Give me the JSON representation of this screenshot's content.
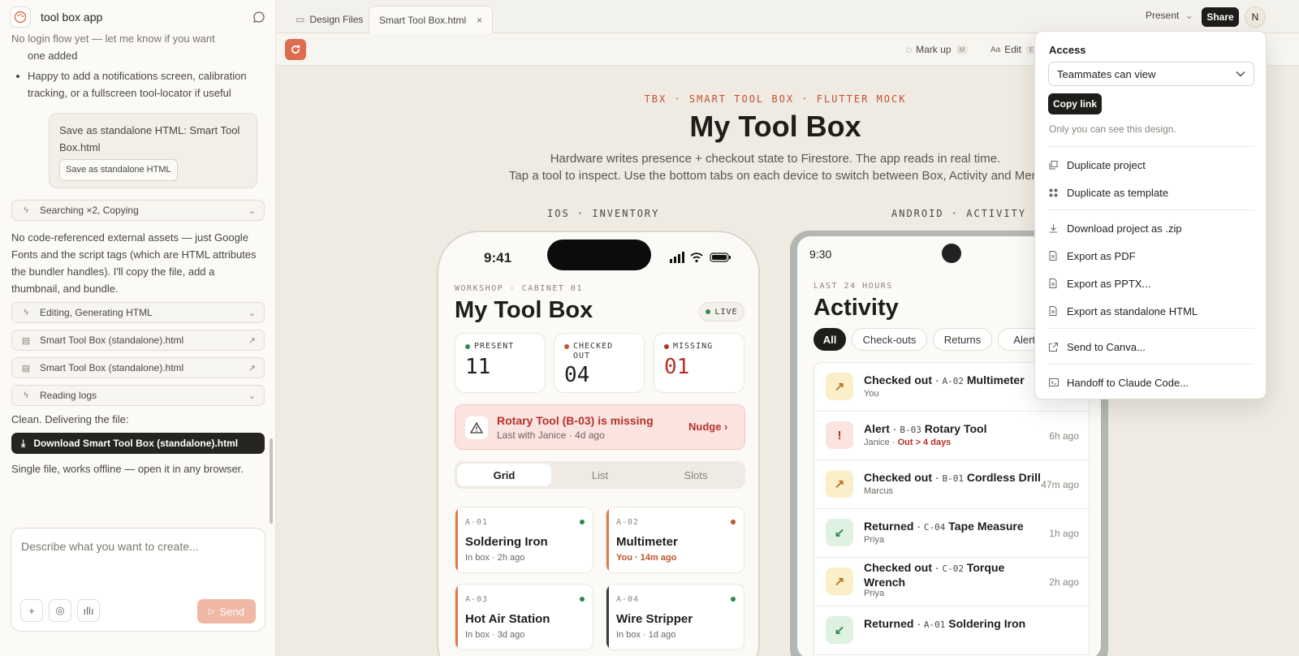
{
  "chat": {
    "project_title": "tool box app",
    "faded_line": "No login flow yet — let me know if you want",
    "faded_line2": "one added",
    "bullet": "Happy to add a notifications screen, calibration tracking, or a fullscreen tool-locator if useful",
    "user_msg": "Save as standalone HTML: Smart Tool Box.html",
    "user_chip": "Save as standalone HTML",
    "step1": "Searching ×2, Copying",
    "para1": "No code-referenced external assets — just Google Fonts and the script tags (which are HTML attributes the bundler handles). I'll copy the file, add a thumbnail, and bundle.",
    "step2": "Editing, Generating HTML",
    "file1": "Smart Tool Box (standalone).html",
    "file2": "Smart Tool Box (standalone).html",
    "step3": "Reading logs",
    "para2": "Clean. Delivering the file:",
    "download_label": "Download Smart Tool Box (standalone).html",
    "para3": "Single file, works offline — open it in any browser.",
    "composer_placeholder": "Describe what you want to create...",
    "send_label": "Send"
  },
  "topbar": {
    "tab1": "Design Files",
    "tab2": "Smart Tool Box.html",
    "present": "Present",
    "share": "Share",
    "avatar": "N"
  },
  "canvas_tools": {
    "markup": "Mark up",
    "markup_key": "M",
    "edit": "Edit",
    "edit_key": "E"
  },
  "hero": {
    "eyebrow": "TBX · SMART TOOL BOX · FLUTTER MOCK",
    "title": "My Tool Box",
    "sub1": "Hardware writes presence + checkout state to Firestore. The app reads in real time.",
    "sub2": "Tap a tool to inspect. Use the bottom tabs on each device to switch between Box, Activity and Mem"
  },
  "ios": {
    "label": "IOS · INVENTORY",
    "time": "9:41",
    "eyebrow": "WORKSHOP · CABINET 01",
    "title": "My Tool Box",
    "live": "LIVE",
    "stats": [
      {
        "label": "PRESENT",
        "value": "11",
        "color": "#2f8a4c"
      },
      {
        "label": "CHECKED OUT",
        "value": "04",
        "color": "#c2512e"
      },
      {
        "label": "MISSING",
        "value": "01",
        "color": "#b4332a"
      }
    ],
    "alert_title": "Rotary Tool (B-03) is missing",
    "alert_sub": "Last with Janice · 4d ago",
    "nudge": "Nudge ›",
    "segments": [
      "Grid",
      "List",
      "Slots"
    ],
    "tools": [
      {
        "code": "A-01",
        "name": "Soldering Iron",
        "sub": "In box · 2h ago",
        "status_color": "#2f8a4c",
        "bar_color": "#e07a45"
      },
      {
        "code": "A-02",
        "name": "Multimeter",
        "sub": "You · 14m ago",
        "status_color": "#c2512e",
        "bar_color": "#e07a45"
      },
      {
        "code": "A-03",
        "name": "Hot Air Station",
        "sub": "In box · 3d ago",
        "status_color": "#2f8a4c",
        "bar_color": "#e07a45"
      },
      {
        "code": "A-04",
        "name": "Wire Stripper",
        "sub": "In box · 1d ago",
        "status_color": "#2f8a4c",
        "bar_color": "#3a3a44"
      }
    ]
  },
  "android": {
    "label": "ANDROID · ACTIVITY",
    "time": "9:30",
    "eyebrow": "LAST 24 HOURS",
    "title": "Activity",
    "filters": [
      "All",
      "Check-outs",
      "Returns",
      "Alerts"
    ],
    "rows": [
      {
        "icon": "↗",
        "kind": "Checked out",
        "code": "A-02",
        "tool": "Multimeter",
        "sub": "You",
        "sub_extra": "",
        "time": ""
      },
      {
        "icon": "!",
        "kind": "Alert",
        "code": "B-03",
        "tool": "Rotary Tool",
        "sub": "Janice",
        "sub_extra": "Out > 4 days",
        "time": "6h ago"
      },
      {
        "icon": "↗",
        "kind": "Checked out",
        "code": "B-01",
        "tool": "Cordless Drill",
        "sub": "Marcus",
        "sub_extra": "",
        "time": "47m ago"
      },
      {
        "icon": "↙",
        "kind": "Returned",
        "code": "C-04",
        "tool": "Tape Measure",
        "sub": "Priya",
        "sub_extra": "",
        "time": "1h ago"
      },
      {
        "icon": "↗",
        "kind": "Checked out",
        "code": "C-02",
        "tool": "Torque Wrench",
        "sub": "Priya",
        "sub_extra": "",
        "time": "2h ago"
      },
      {
        "icon": "↙",
        "kind": "Returned",
        "code": "A-01",
        "tool": "Soldering Iron",
        "sub": "",
        "sub_extra": "",
        "time": ""
      }
    ]
  },
  "share_popover": {
    "access_label": "Access",
    "access_value": "Teammates can view",
    "copy_link": "Copy link",
    "only_you": "Only you can see this design.",
    "items": [
      "Duplicate project",
      "Duplicate as template",
      "Download project as .zip",
      "Export as PDF",
      "Export as PPTX...",
      "Export as standalone HTML",
      "Send to Canva...",
      "Handoff to Claude Code..."
    ]
  }
}
